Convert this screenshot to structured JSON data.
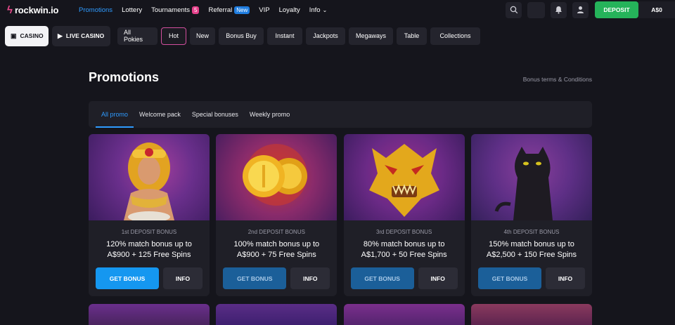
{
  "brand": {
    "name": "rockwin.io"
  },
  "nav": {
    "items": [
      {
        "label": "Promotions",
        "active": true
      },
      {
        "label": "Lottery"
      },
      {
        "label": "Tournaments",
        "badge": "5",
        "badge_color": "pink"
      },
      {
        "label": "Referral",
        "badge": "New",
        "badge_color": "blue"
      },
      {
        "label": "VIP"
      },
      {
        "label": "Loyalty"
      },
      {
        "label": "Info",
        "dropdown": true
      }
    ]
  },
  "header_right": {
    "deposit_label": "DEPOSIT",
    "balance": "A$0"
  },
  "modes": {
    "casino": "CASINO",
    "live": "LIVE CASINO"
  },
  "categories": [
    "All Pokies",
    "Hot",
    "New",
    "Bonus Buy",
    "Instant",
    "Jackpots",
    "Megaways",
    "Table",
    "Collections"
  ],
  "page": {
    "title": "Promotions",
    "terms_link": "Bonus terms & Conditions"
  },
  "tabs": [
    "All promo",
    "Welcome pack",
    "Special bonuses",
    "Weekly promo"
  ],
  "cards": [
    {
      "label": "1st DEPOSIT BONUS",
      "desc_line1": "120% match bonus up to",
      "desc_line2": "A$900 + 125 Free Spins",
      "get": "GET BONUS",
      "info": "INFO"
    },
    {
      "label": "2nd DEPOSIT BONUS",
      "desc_line1": "100% match bonus up to",
      "desc_line2": "A$900 + 75 Free Spins",
      "get": "GET BONUS",
      "info": "INFO"
    },
    {
      "label": "3rd DEPOSIT BONUS",
      "desc_line1": "80% match bonus up to",
      "desc_line2": "A$1,700 + 50 Free Spins",
      "get": "GET BONUS",
      "info": "INFO"
    },
    {
      "label": "4th DEPOSIT BONUS",
      "desc_line1": "150% match bonus up to",
      "desc_line2": "A$2,500 + 150 Free Spins",
      "get": "GET BONUS",
      "info": "INFO"
    }
  ],
  "colors": {
    "accent_blue": "#1597f0",
    "deposit_green": "#25b35a",
    "hot_border": "#d24f9e"
  },
  "icons": [
    "bolt-icon",
    "search-icon",
    "bell-icon",
    "user-icon",
    "casino-icon",
    "play-icon",
    "chevron-down-icon"
  ]
}
